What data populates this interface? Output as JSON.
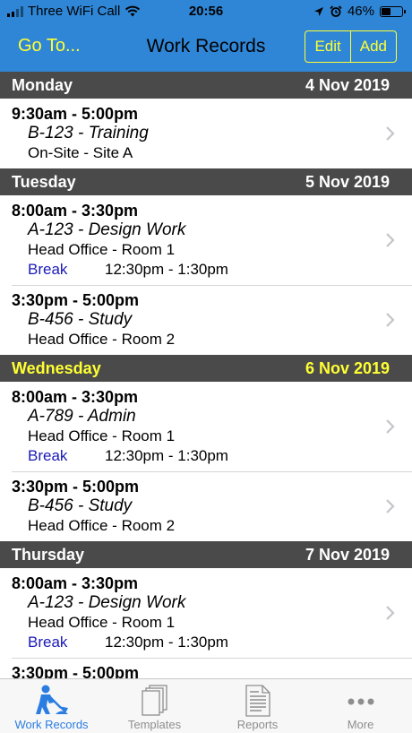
{
  "status_bar": {
    "carrier": "Three WiFi Call",
    "time": "20:56",
    "battery": "46%",
    "battery_level": 0.46
  },
  "nav": {
    "goto_label": "Go To...",
    "title": "Work Records",
    "edit_label": "Edit",
    "add_label": "Add"
  },
  "days": [
    {
      "name": "Monday",
      "date": "4 Nov 2019",
      "today": false,
      "records": [
        {
          "time": "9:30am - 5:00pm",
          "task": "B-123 - Training",
          "location": "On-Site - Site A"
        }
      ]
    },
    {
      "name": "Tuesday",
      "date": "5 Nov 2019",
      "today": false,
      "records": [
        {
          "time": "8:00am - 3:30pm",
          "task": "A-123 - Design Work",
          "location": "Head Office - Room 1",
          "break_label": "Break",
          "break_time": "12:30pm - 1:30pm"
        },
        {
          "time": "3:30pm - 5:00pm",
          "task": "B-456 - Study",
          "location": "Head Office - Room 2"
        }
      ]
    },
    {
      "name": "Wednesday",
      "date": "6 Nov 2019",
      "today": true,
      "records": [
        {
          "time": "8:00am - 3:30pm",
          "task": "A-789 - Admin",
          "location": "Head Office - Room 1",
          "break_label": "Break",
          "break_time": "12:30pm - 1:30pm"
        },
        {
          "time": "3:30pm - 5:00pm",
          "task": "B-456 - Study",
          "location": "Head Office - Room 2"
        }
      ]
    },
    {
      "name": "Thursday",
      "date": "7 Nov 2019",
      "today": false,
      "records": [
        {
          "time": "8:00am - 3:30pm",
          "task": "A-123 - Design Work",
          "location": "Head Office - Room 1",
          "break_label": "Break",
          "break_time": "12:30pm - 1:30pm"
        },
        {
          "time": "3:30pm - 5:00pm",
          "task": "",
          "location": ""
        }
      ]
    }
  ],
  "tabs": [
    {
      "label": "Work Records",
      "icon": "worker-digging-icon",
      "active": true
    },
    {
      "label": "Templates",
      "icon": "templates-stack-icon",
      "active": false
    },
    {
      "label": "Reports",
      "icon": "report-document-icon",
      "active": false
    },
    {
      "label": "More",
      "icon": "more-dots-icon",
      "active": false
    }
  ],
  "colors": {
    "nav_background": "#2f86d6",
    "accent_yellow": "#ffff33",
    "day_header_background": "#4a4a4a",
    "break_label": "#1a1ab8",
    "tab_active": "#2a7de1"
  }
}
